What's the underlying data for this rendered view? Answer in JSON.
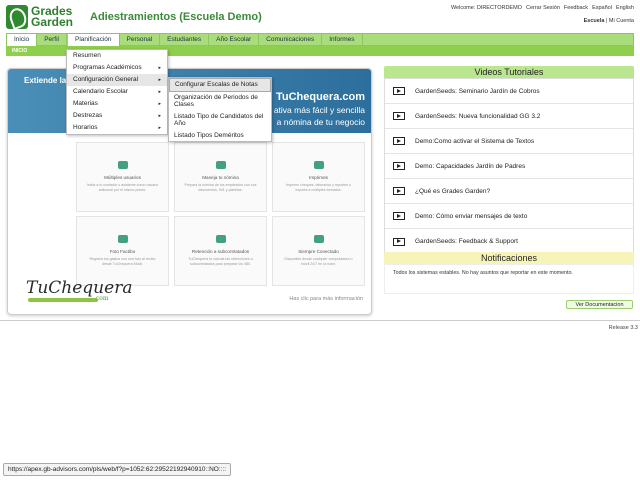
{
  "header": {
    "logo_line1": "Grades",
    "logo_line2": "Garden",
    "title": "Adiestramientos (Escuela Demo)",
    "welcome": "Welcome: DIRECTORDEMO",
    "logout": "Cerrar Sesión",
    "feedback": "Feedback",
    "lang_es": "Español",
    "lang_en": "English",
    "school": "Escuela",
    "account": "Mi Cuenta"
  },
  "nav": {
    "items": [
      "Inicio",
      "Perfil",
      "Planificación",
      "Personal",
      "Estudiantes",
      "Año Escolar",
      "Comunicaciones",
      "Informes"
    ],
    "sub": "INICIO"
  },
  "menu": {
    "items": [
      {
        "label": "Resumen",
        "arrow": ""
      },
      {
        "label": "Programas Académicos",
        "arrow": "▸"
      },
      {
        "label": "Configuración General",
        "arrow": "▸"
      },
      {
        "label": "Calendario Escolar",
        "arrow": "▸"
      },
      {
        "label": "Materias",
        "arrow": "▸"
      },
      {
        "label": "Destrezas",
        "arrow": "▸"
      },
      {
        "label": "Horarios",
        "arrow": "▸"
      }
    ],
    "submenu": [
      "Configurar Escalas de Notas",
      "Organización de Periodos de Clases",
      "Listado Tipo de Candidatos del Año",
      "Listado Tipos Deméritos"
    ]
  },
  "promo": {
    "left_text": "Extiende la",
    "brand": "TuChequera.com",
    "line1": "ativa más fácil y sencilla",
    "line2": "a nómina de tu negocio",
    "features": [
      {
        "title": "Múltiples usuarios",
        "desc": "Invita a tu contador o asistente como usuario adicional por el mismo precio."
      },
      {
        "title": "Maneja tu nómina",
        "desc": "Prepara la nómina de tus empleados con sus descuentos, 941 y planillas."
      },
      {
        "title": "Imprimes",
        "desc": "Imprime cheques, talonarios y reportes o exporta a múltiples formatos."
      },
      {
        "title": "Foto Factibo",
        "desc": "Registra tus gastos con una foto al recibo desde TuChequera Móvil."
      },
      {
        "title": "Retención a subcontratados",
        "desc": "TuChequera te calcula las retenciones a subcontratados para preparar los 480."
      },
      {
        "title": "Siempre Conectado",
        "desc": "Disponible desde cualquier computadora o móvil 24/7 en la nube."
      }
    ],
    "logo": "TuChequera",
    "logo_com": ".com",
    "click_hint": "Has clic para más información"
  },
  "videos": {
    "title": "Videos Tutoriales",
    "items": [
      "GardenSeeds: Seminario Jardín de Cobros",
      "GardenSeeds: Nueva funcionalidad GG 3.2",
      "Demo:Como activar el Sistema de Textos",
      "Demo: Capacidades Jardín de Padres",
      "¿Qué es Grades Garden?",
      "Demo: Cómo enviar mensajes de texto",
      "GardenSeeds: Feedback & Support"
    ]
  },
  "notifications": {
    "title": "Notificaciones",
    "text": "Todos los sistemas estables. No hay asuntos que reportar en este momento."
  },
  "docs_button": "Ver Documentacion",
  "release": "Release 3.3",
  "statusbar": "https://apex.gb-advisors.com/pls/web/f?p=1052:62:29522192940910::NO::::"
}
